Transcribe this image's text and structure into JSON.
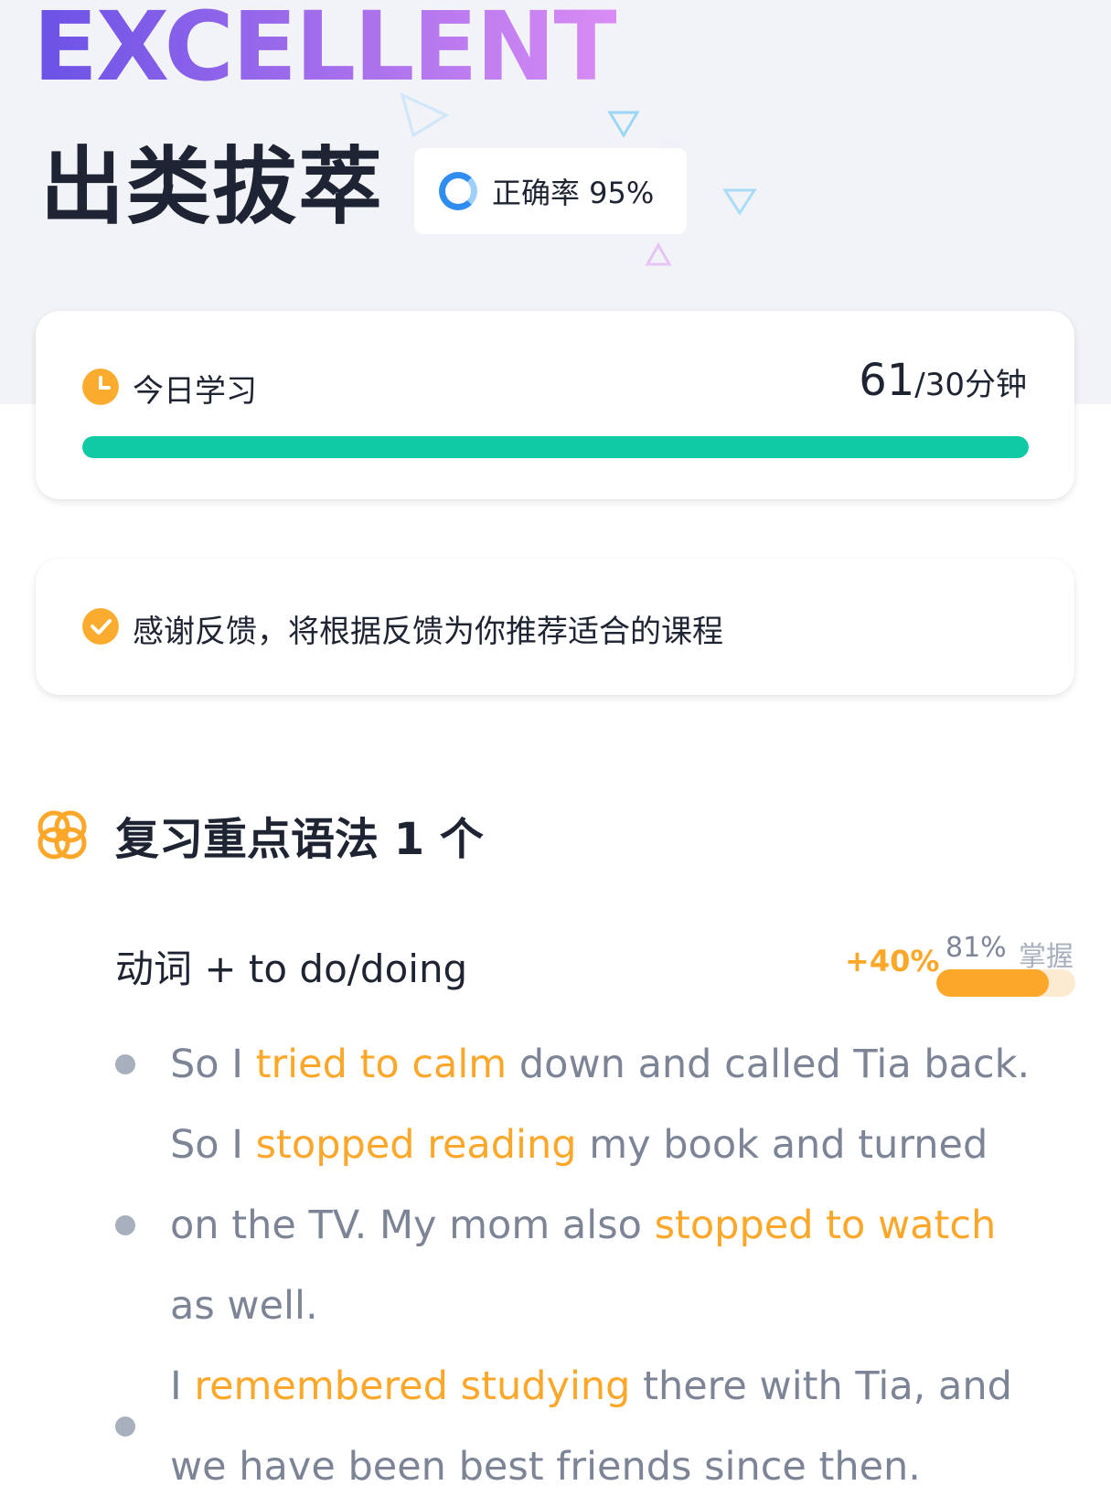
{
  "hero": {
    "banner_text": "EXCELLENT",
    "title": "出类拔萃",
    "accuracy_label": "正确率 95%"
  },
  "study": {
    "label": "今日学习",
    "minutes_done": "61",
    "goal_text": "/30分钟",
    "progress": 1.0
  },
  "feedback": {
    "message": "感谢反馈，将根据反馈为你推荐适合的课程"
  },
  "review": {
    "title": "复习重点语法 1 个",
    "grammar": {
      "name": "动词 + to do/doing",
      "delta": "+40%",
      "mastery_pct": "81%",
      "mastery_word": "掌握",
      "mastery": 0.81
    },
    "examples": [
      {
        "before": "So I ",
        "highlight": "tried to calm",
        "middle": " down and called Tia back.",
        "highlight2": "",
        "after": ""
      },
      {
        "before": "So I ",
        "highlight": "stopped reading",
        "middle": " my book and turned on the TV. My mom also ",
        "highlight2": "stopped to watch",
        "after": " as well."
      },
      {
        "before": "I ",
        "highlight": "remembered studying",
        "middle": " there with Tia, and we have been best friends since then.",
        "highlight2": "",
        "after": ""
      }
    ]
  },
  "colors": {
    "accent_orange": "#fba72a",
    "progress_green": "#10c9a5",
    "ring_blue": "#2f8df0"
  },
  "icons": {
    "accuracy": "ring-chart-icon",
    "study": "clock-icon",
    "feedback": "check-circle-icon",
    "section": "knot-icon"
  }
}
